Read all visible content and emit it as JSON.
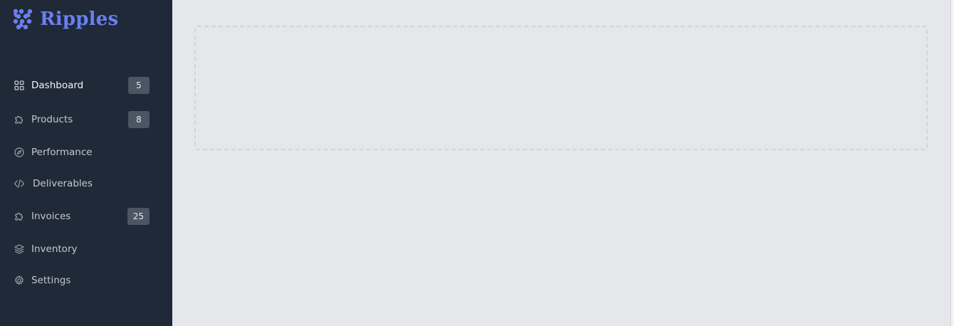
{
  "brand": {
    "name": "Ripples",
    "logo_icon": "dots-grid-logo",
    "color": "#6b7ff0"
  },
  "sidebar": {
    "background": "#1f2937",
    "items": [
      {
        "label": "Dashboard",
        "icon": "grid-icon",
        "badge": "5",
        "active": true
      },
      {
        "label": "Products",
        "icon": "puzzle-icon",
        "badge": "8"
      },
      {
        "label": "Performance",
        "icon": "compass-icon",
        "badge": null
      },
      {
        "label": "Deliverables",
        "icon": "code-icon",
        "badge": null
      },
      {
        "label": "Invoices",
        "icon": "puzzle-icon",
        "badge": "25"
      },
      {
        "label": "Inventory",
        "icon": "layers-icon",
        "badge": null
      },
      {
        "label": "Settings",
        "icon": "gear-icon",
        "badge": null
      }
    ]
  },
  "main": {
    "background": "#e5e7eb",
    "placeholder_border": "#d1d5db"
  }
}
